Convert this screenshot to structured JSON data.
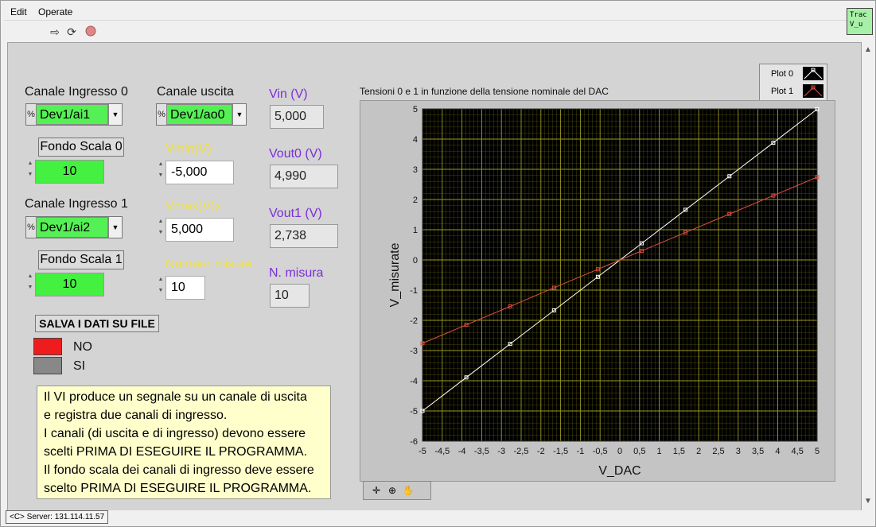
{
  "menu": {
    "edit": "Edit",
    "operate": "Operate"
  },
  "vi_icon": {
    "line1": "Trac",
    "line2": "V_u"
  },
  "status": {
    "server": "<C> Server: 131.114.11.57"
  },
  "controls": {
    "canale_ingresso_0": {
      "label": "Canale Ingresso 0",
      "value": "Dev1/ai1",
      "prefix": "%"
    },
    "fondo_scala_0": {
      "label": "Fondo Scala 0",
      "value": "10"
    },
    "canale_ingresso_1": {
      "label": "Canale Ingresso 1",
      "value": "Dev1/ai2",
      "prefix": "%"
    },
    "fondo_scala_1": {
      "label": "Fondo Scala 1",
      "value": "10"
    },
    "canale_uscita": {
      "label": "Canale uscita",
      "value": "Dev1/ao0",
      "prefix": "%"
    },
    "vmin": {
      "label": "Vmin(V)",
      "value": "-5,000"
    },
    "vmax": {
      "label": "Vmax(V)x",
      "value": "5,000"
    },
    "numero_misure": {
      "label": "Numero misure",
      "value": "10"
    },
    "vin": {
      "label": "Vin (V)",
      "value": "5,000"
    },
    "vout0": {
      "label": "Vout0 (V)",
      "value": "4,990"
    },
    "vout1": {
      "label": "Vout1 (V)",
      "value": "2,738"
    },
    "n_misura": {
      "label": "N. misura",
      "value": "10"
    },
    "salva": {
      "label": "SALVA I DATI SU FILE",
      "no": "NO",
      "si": "SI",
      "selected": "NO"
    }
  },
  "note": {
    "lines": [
      "Il VI produce un segnale su un canale di uscita",
      "e registra due canali di ingresso.",
      "I canali (di uscita e di ingresso) devono essere",
      "scelti PRIMA DI ESEGUIRE IL PROGRAMMA.",
      "Il fondo scala dei canali di ingresso deve essere",
      "scelto PRIMA DI ESEGUIRE IL PROGRAMMA."
    ]
  },
  "colors": {
    "green": "#44f040",
    "yellow_label": "#f0e040",
    "purple_label": "#7a2fd6",
    "plot_bg": "#000000",
    "grid": "#9a9a20",
    "plot0": "#ffffff",
    "plot1": "#e05040"
  },
  "chart_data": {
    "type": "line",
    "title": "Tensioni 0 e 1 in funzione della tensione nominale del DAC",
    "xlabel": "V_DAC",
    "ylabel": "V_misurate",
    "xlim": [
      -5,
      5
    ],
    "ylim": [
      -6,
      5
    ],
    "xticks": [
      "-5",
      "-4,5",
      "-4",
      "-3,5",
      "-3",
      "-2,5",
      "-2",
      "-1,5",
      "-1",
      "-0,5",
      "0",
      "0,5",
      "1",
      "1,5",
      "2",
      "2,5",
      "3",
      "3,5",
      "4",
      "4,5",
      "5"
    ],
    "yticks": [
      "-6",
      "-5",
      "-4",
      "-3",
      "-2",
      "-1",
      "0",
      "1",
      "2",
      "3",
      "4",
      "5"
    ],
    "grid": true,
    "legend_position": "top-right",
    "series": [
      {
        "name": "Plot 0",
        "x": [
          -5,
          -3.889,
          -2.778,
          -1.667,
          -0.556,
          0.556,
          1.667,
          2.778,
          3.889,
          5
        ],
        "y": [
          -5.0,
          -3.89,
          -2.78,
          -1.67,
          -0.56,
          0.55,
          1.66,
          2.77,
          3.88,
          4.99
        ]
      },
      {
        "name": "Plot 1",
        "x": [
          -5,
          -3.889,
          -2.778,
          -1.667,
          -0.556,
          0.556,
          1.667,
          2.778,
          3.889,
          5
        ],
        "y": [
          -2.76,
          -2.15,
          -1.54,
          -0.92,
          -0.31,
          0.3,
          0.91,
          1.52,
          2.13,
          2.74
        ]
      }
    ]
  }
}
